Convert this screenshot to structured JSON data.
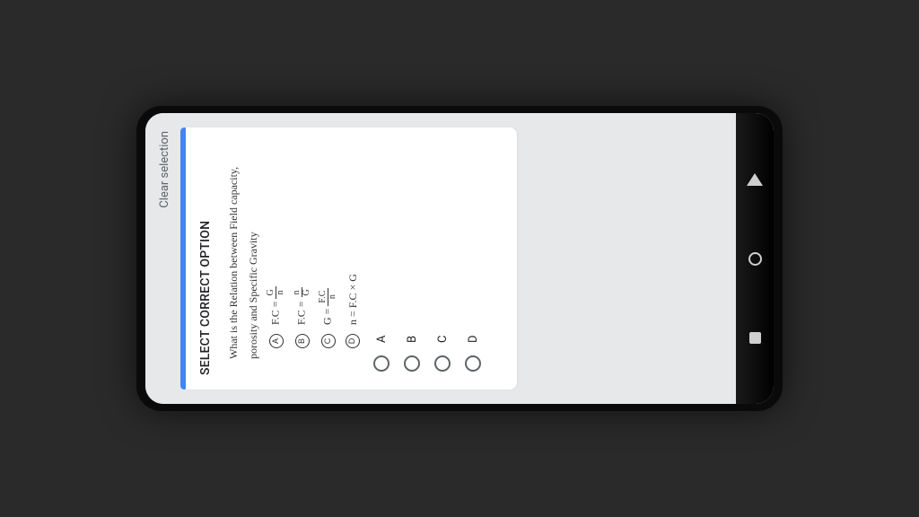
{
  "header": {
    "clear_selection": "Clear selection"
  },
  "card": {
    "title": "SELECT CORRECT OPTION",
    "question_line1": "What is the Relation between Field capacity,",
    "question_line2": "porosity and Specific Gravity",
    "written_options": {
      "a_label": "A",
      "a_prefix": "F.C =",
      "a_num": "G",
      "a_den": "n",
      "b_label": "B",
      "b_prefix": "F.C =",
      "b_num": "n",
      "b_den": "G",
      "c_label": "C",
      "c_prefix": "G =",
      "c_num": "F.C",
      "c_den": "n",
      "d_label": "D",
      "d_formula": "n = F.C × G"
    },
    "answers": {
      "a": "A",
      "b": "B",
      "c": "C",
      "d": "D"
    }
  }
}
